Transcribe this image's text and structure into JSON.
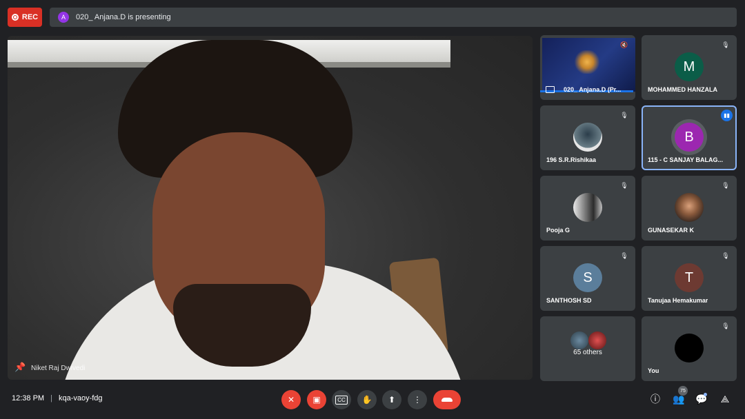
{
  "header": {
    "rec_label": "REC",
    "presenter_initial": "A",
    "presenting_text": "020_ Anjana.D is presenting"
  },
  "main": {
    "speaker_name": "Niket Raj Dwivedi"
  },
  "participants": [
    {
      "name": "020_ Anjana.D (Pr...",
      "type": "screen"
    },
    {
      "name": "MOHAMMED HANZALA",
      "initial": "M",
      "color": "#0b5d48"
    },
    {
      "name": "196 S.R.Rishikaa",
      "type": "photo"
    },
    {
      "name": "115 - C SANJAY BALAG...",
      "initial": "B",
      "color": "#9c27b0",
      "active": true
    },
    {
      "name": "Pooja G",
      "type": "photo"
    },
    {
      "name": "GUNASEKAR K",
      "type": "photo"
    },
    {
      "name": "SANTHOSH SD",
      "initial": "S",
      "color": "#5b7e9b"
    },
    {
      "name": "Tanujaa Hemakumar",
      "initial": "T",
      "color": "#6d3a32"
    },
    {
      "label": "65 others",
      "type": "others"
    },
    {
      "name": "You",
      "type": "self"
    }
  ],
  "footer": {
    "time": "12:38 PM",
    "meeting_code": "kqa-vaoy-fdg",
    "people_count": "75"
  },
  "icons": [
    "mic-off-icon",
    "camera-off-icon",
    "captions-icon",
    "hand-icon",
    "present-icon",
    "more-icon",
    "hangup-icon",
    "info-icon",
    "people-icon",
    "chat-icon",
    "activities-icon"
  ]
}
